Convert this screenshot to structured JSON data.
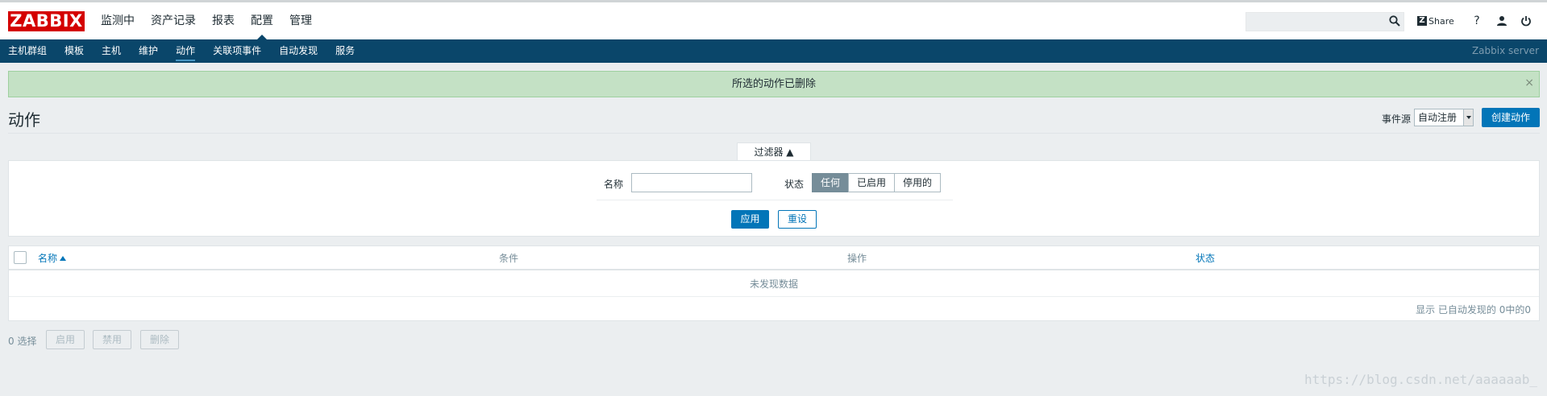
{
  "header": {
    "logo": "ZABBIX",
    "menu": [
      {
        "label": "监测中"
      },
      {
        "label": "资产记录"
      },
      {
        "label": "报表"
      },
      {
        "label": "配置",
        "selected": true
      },
      {
        "label": "管理"
      }
    ],
    "search": {
      "value": "",
      "placeholder": ""
    },
    "share_label": "Share",
    "help_label": "?"
  },
  "subnav": {
    "items": [
      {
        "label": "主机群组"
      },
      {
        "label": "模板"
      },
      {
        "label": "主机"
      },
      {
        "label": "维护"
      },
      {
        "label": "动作",
        "selected": true
      },
      {
        "label": "关联项事件"
      },
      {
        "label": "自动发现"
      },
      {
        "label": "服务"
      }
    ],
    "server_name": "Zabbix server"
  },
  "message": {
    "text": "所选的动作已删除",
    "close": "×"
  },
  "page": {
    "title": "动作",
    "event_source_label": "事件源",
    "event_source_value": "自动注册",
    "create_button": "创建动作"
  },
  "filter": {
    "tab_label": "过滤器 ▲",
    "name_label": "名称",
    "name_value": "",
    "status_label": "状态",
    "status_options": [
      {
        "label": "任何",
        "active": true
      },
      {
        "label": "已启用",
        "active": false
      },
      {
        "label": "停用的",
        "active": false
      }
    ],
    "apply_button": "应用",
    "reset_button": "重设"
  },
  "table": {
    "columns": [
      {
        "label": "名称",
        "sortable": true
      },
      {
        "label": "条件",
        "sortable": false
      },
      {
        "label": "操作",
        "sortable": false
      },
      {
        "label": "状态",
        "sortable": true
      }
    ],
    "no_data": "未发现数据",
    "paging": "显示 已自动发现的 0中的0"
  },
  "bottom": {
    "selected_count": "0 选择",
    "buttons": [
      "启用",
      "禁用",
      "删除"
    ]
  },
  "watermark": "https://blog.csdn.net/aaaaaab_",
  "colors": {
    "logo_red": "#d40000",
    "nav_blue": "#0a466a",
    "primary": "#0275b8",
    "success_bg": "#c4e1c5"
  }
}
